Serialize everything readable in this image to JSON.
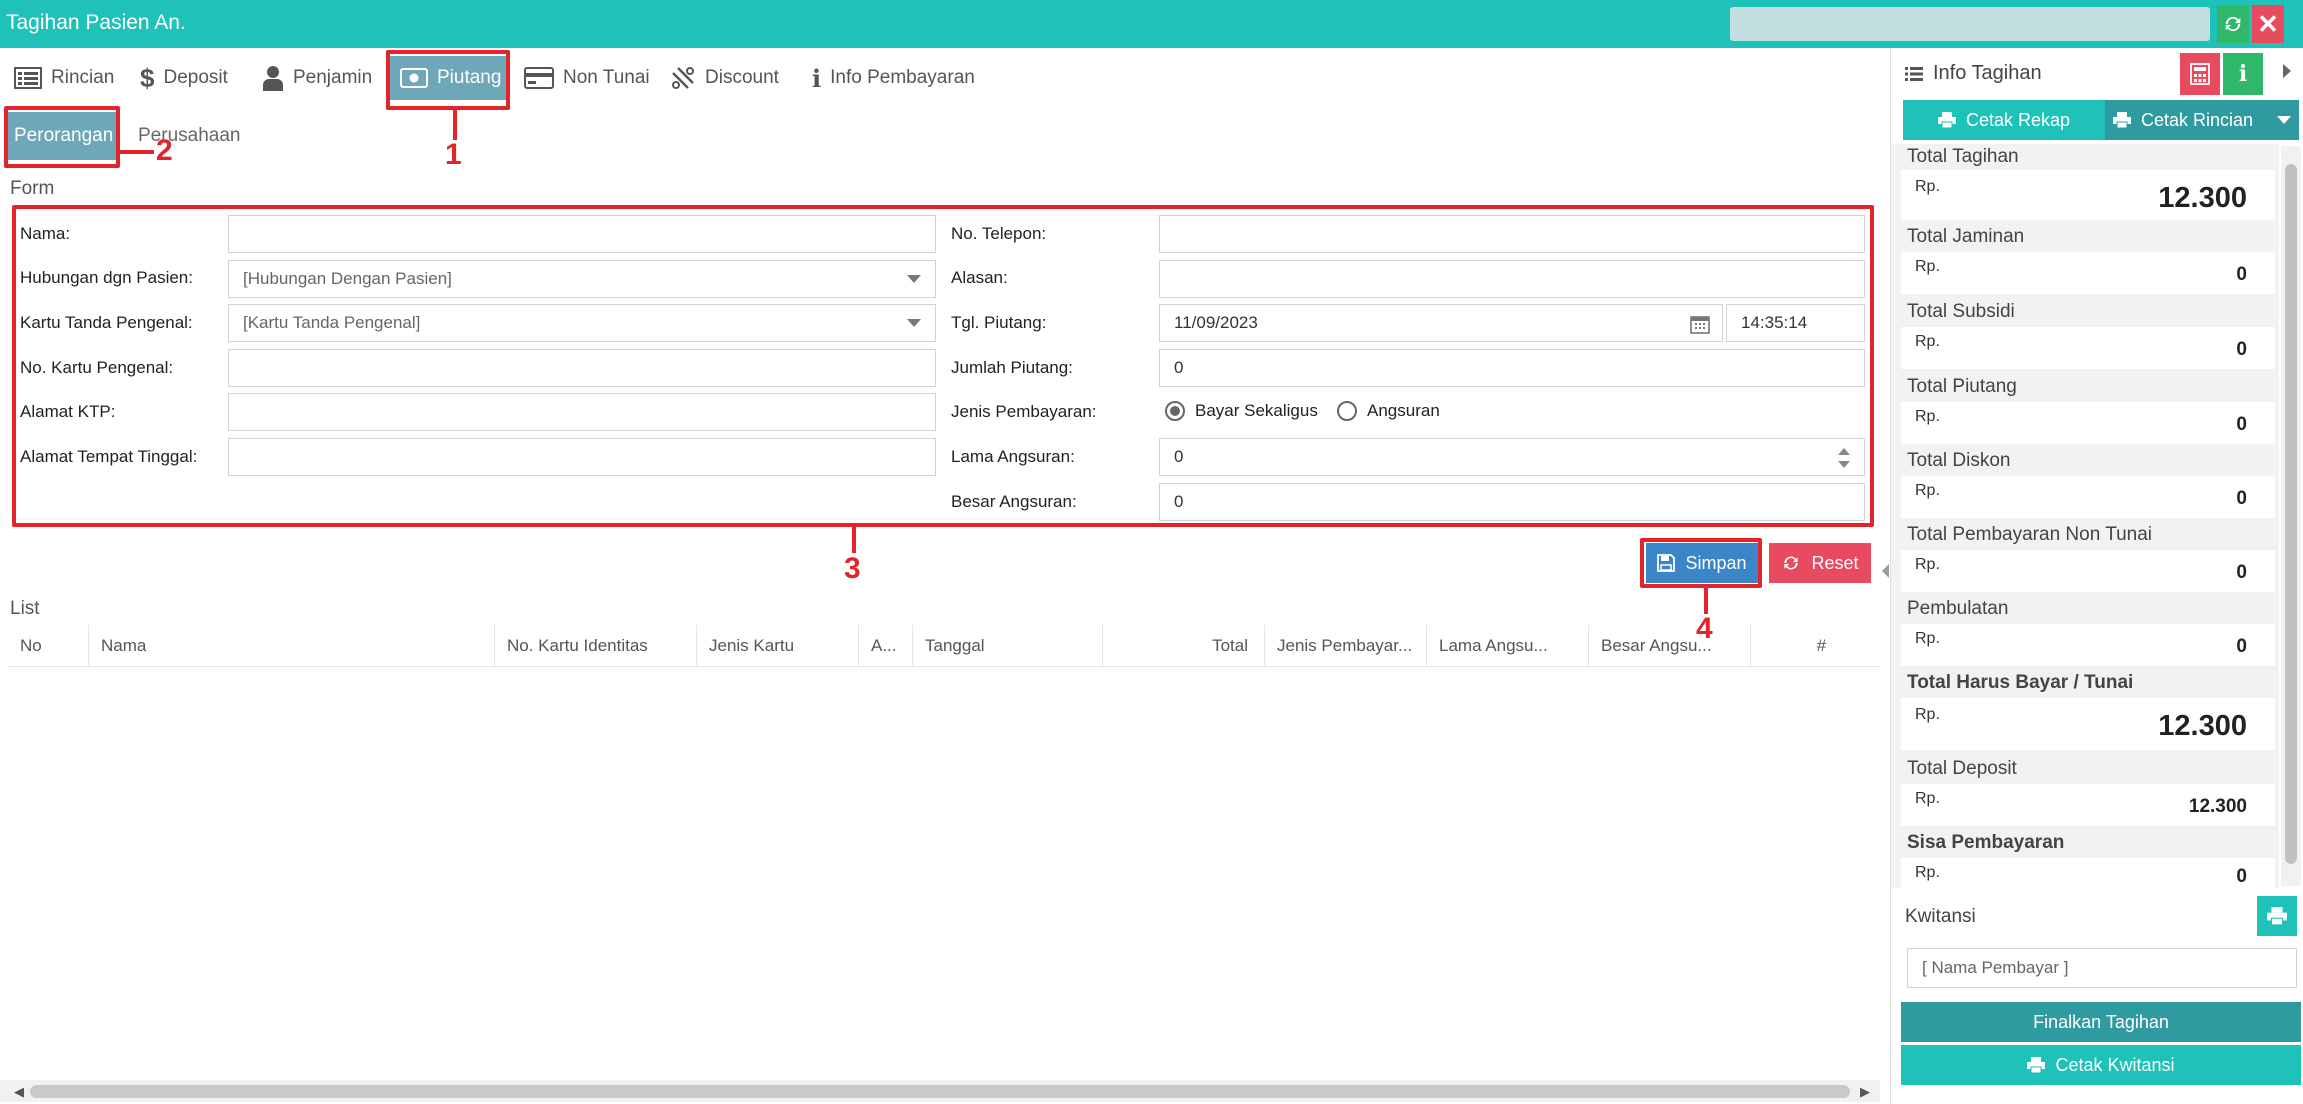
{
  "window": {
    "title": "Tagihan Pasien An."
  },
  "tabs": [
    {
      "label": "Rincian",
      "icon": "list-icon"
    },
    {
      "label": "Deposit",
      "icon": "dollar-icon"
    },
    {
      "label": "Penjamin",
      "icon": "user-icon"
    },
    {
      "label": "Piutang",
      "icon": "money-icon"
    },
    {
      "label": "Non Tunai",
      "icon": "credit-card-icon"
    },
    {
      "label": "Discount",
      "icon": "percent-icon"
    },
    {
      "label": "Info Pembayaran",
      "icon": "info-icon"
    }
  ],
  "subtabs": [
    "Perorangan",
    "Perusahaan"
  ],
  "form": {
    "section_label": "Form",
    "left": {
      "nama": "Nama:",
      "hubungan": "Hubungan dgn Pasien:",
      "hubungan_value": "[Hubungan Dengan Pasien]",
      "kartu": "Kartu Tanda Pengenal:",
      "kartu_value": "[Kartu Tanda Pengenal]",
      "no_kartu": "No. Kartu Pengenal:",
      "alamat_ktp": "Alamat KTP:",
      "alamat_tinggal": "Alamat Tempat Tinggal:"
    },
    "right": {
      "telepon": "No. Telepon:",
      "alasan": "Alasan:",
      "tgl_piutang": "Tgl. Piutang:",
      "tgl_value": "11/09/2023",
      "time_value": "14:35:14",
      "jumlah": "Jumlah Piutang:",
      "jumlah_value": "0",
      "jenis": "Jenis Pembayaran:",
      "opt_sekaligus": "Bayar Sekaligus",
      "opt_angsuran": "Angsuran",
      "lama": "Lama Angsuran:",
      "lama_value": "0",
      "besar": "Besar Angsuran:",
      "besar_value": "0"
    }
  },
  "buttons": {
    "simpan": "Simpan",
    "reset": "Reset"
  },
  "list": {
    "section_label": "List",
    "columns": [
      "No",
      "Nama",
      "No. Kartu Identitas",
      "Jenis Kartu",
      "A...",
      "Tanggal",
      "Total",
      "Jenis Pembayar...",
      "Lama Angsu...",
      "Besar Angsu...",
      "#"
    ]
  },
  "annotations": [
    "1",
    "2",
    "3",
    "4"
  ],
  "info_tagihan": {
    "title": "Info Tagihan",
    "cetak_rekap": "Cetak Rekap",
    "cetak_rincian": "Cetak Rincian",
    "currency": "Rp.",
    "items": [
      {
        "label": "Total Tagihan",
        "value": "12.300"
      },
      {
        "label": "Total Jaminan",
        "value": "0"
      },
      {
        "label": "Total Subsidi",
        "value": "0"
      },
      {
        "label": "Total Piutang",
        "value": "0"
      },
      {
        "label": "Total Diskon",
        "value": "0"
      },
      {
        "label": "Total Pembayaran Non Tunai",
        "value": "0"
      },
      {
        "label": "Pembulatan",
        "value": "0"
      },
      {
        "label": "Total Harus Bayar / Tunai",
        "value": "12.300"
      },
      {
        "label": "Total Deposit",
        "value": "12.300"
      },
      {
        "label": "Sisa Pembayaran",
        "value": "0"
      }
    ],
    "kwitansi": "Kwitansi",
    "nama_pembayar": "[ Nama Pembayar ]",
    "finalkan": "Finalkan Tagihan",
    "cetak_kwitansi": "Cetak Kwitansi"
  },
  "colors": {
    "teal": "#1ec2b8",
    "active_tab": "#6ea7b8",
    "annotation": "#e3252b",
    "save": "#3a86c8",
    "reset": "#e84a5f"
  }
}
